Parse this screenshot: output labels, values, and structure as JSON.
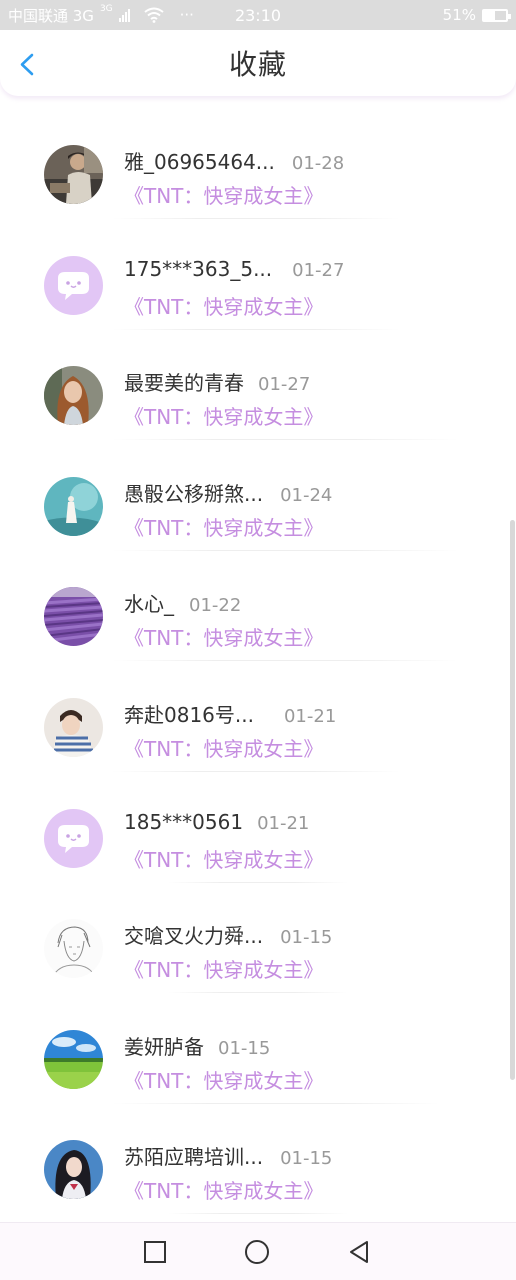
{
  "status_bar": {
    "carrier": "中国联通 3G",
    "network": "3G",
    "more": "···",
    "time": "23:10",
    "battery": "51%",
    "battery_level": 0.51
  },
  "header": {
    "title": "收藏",
    "back_icon": "chevron-left-icon",
    "accent": "#2e9df0"
  },
  "items": [
    {
      "name": "雅_06965464...",
      "date": "01-28",
      "book": "《TNT：快穿成女主》",
      "avatar": "photo-man-dark"
    },
    {
      "name": "175***363_5...",
      "date": "01-27",
      "book": "《TNT：快穿成女主》",
      "avatar": "default-chat-bubble"
    },
    {
      "name": "最要美的青春",
      "date": "01-27",
      "book": "《TNT：快穿成女主》",
      "avatar": "photo-woman-curly"
    },
    {
      "name": "愚骰公移掰煞...",
      "date": "01-24",
      "book": "《TNT：快穿成女主》",
      "avatar": "photo-teal-figure"
    },
    {
      "name": "水心_",
      "date": "01-22",
      "book": "《TNT：快穿成女主》",
      "avatar": "photo-lavender-field"
    },
    {
      "name": "奔赴0816号...",
      "date": "01-21",
      "book": "《TNT：快穿成女主》",
      "avatar": "photo-boy-striped"
    },
    {
      "name": "185***0561",
      "date": "01-21",
      "book": "《TNT：快穿成女主》",
      "avatar": "default-chat-bubble"
    },
    {
      "name": "交嗆叉火力舜...",
      "date": "01-15",
      "book": "《TNT：快穿成女主》",
      "avatar": "sketch-anime-boy"
    },
    {
      "name": "姜妍胪备",
      "date": "01-15",
      "book": "《TNT：快穿成女主》",
      "avatar": "photo-green-field"
    },
    {
      "name": "苏陌应聘培训...",
      "date": "01-15",
      "book": "《TNT：快穿成女主》",
      "avatar": "photo-girl-dark-hair"
    }
  ],
  "nav_bar": {
    "recent_icon": "square-icon",
    "home_icon": "circle-icon",
    "back_icon": "triangle-back-icon"
  },
  "colors": {
    "book_title": "#c58ee0",
    "default_avatar_bg": "#e2c6f5",
    "date": "#999999"
  }
}
